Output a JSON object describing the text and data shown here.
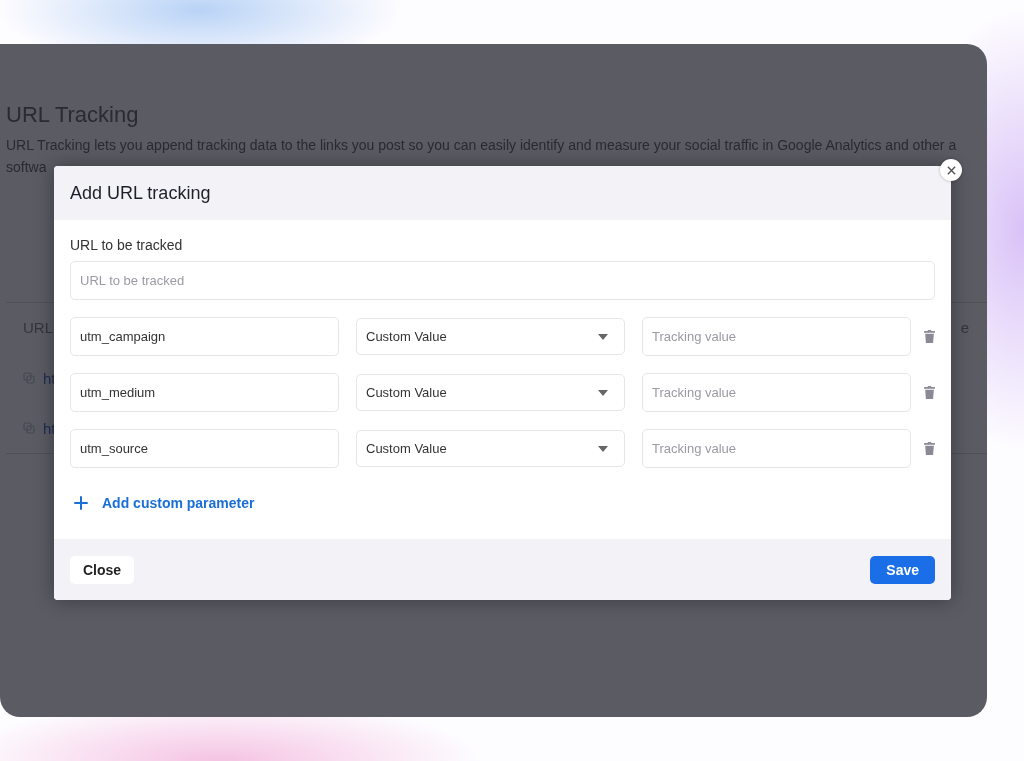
{
  "page": {
    "title": "URL Tracking",
    "description": "URL Tracking lets you append tracking data to the links you post so you can easily identify and measure your social traffic in Google Analytics and other a",
    "description_line_2": "softwa",
    "table": {
      "columns": [
        "URL",
        "e"
      ],
      "rows": [
        {
          "column_1": "ht"
        },
        {
          "column_1": "ht"
        }
      ]
    }
  },
  "dialog": {
    "title": "Add URL tracking",
    "url_label": "URL to be tracked",
    "url_field": {
      "placeholder": "URL to be tracked"
    },
    "parameters": [
      {
        "name": "utm_campaign",
        "source": "Custom Value",
        "value_placeholder": "Tracking value"
      },
      {
        "name": "utm_medium",
        "source": "Custom Value",
        "value_placeholder": "Tracking value"
      },
      {
        "name": "utm_source",
        "source": "Custom Value",
        "value_placeholder": "Tracking value"
      }
    ],
    "add_link": "Add custom parameter",
    "buttons": [
      {
        "label": "Close",
        "kind": "secondary"
      },
      {
        "label": "Save",
        "kind": "primary"
      }
    ]
  }
}
